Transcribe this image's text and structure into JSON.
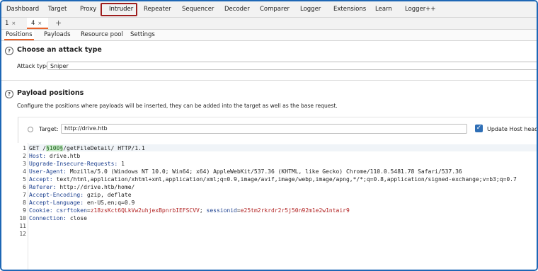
{
  "main_tabs": [
    "Dashboard",
    "Target",
    "Proxy",
    "Intruder",
    "Repeater",
    "Sequencer",
    "Decoder",
    "Comparer",
    "Logger",
    "Extensions",
    "Learn",
    "Logger++"
  ],
  "active_main_tab": "Intruder",
  "instance_tabs": [
    {
      "label": "1",
      "close": "×"
    },
    {
      "label": "4",
      "close": "×"
    }
  ],
  "add_tab_icon": "+",
  "sub_tabs": [
    "Positions",
    "Payloads",
    "Resource pool",
    "Settings"
  ],
  "attack_type_section": {
    "icon": "?",
    "title": "Choose an attack type",
    "label": "Attack type:",
    "value": "Sniper"
  },
  "payload_section": {
    "icon": "?",
    "title": "Payload positions",
    "description": "Configure the positions where payloads will be inserted, they can be added into the target as well as the base request."
  },
  "target": {
    "label": "Target:",
    "value": "http://drive.htb",
    "update_host_label": "Update Host header t",
    "update_host_checked": true
  },
  "request": {
    "line1_prefix": "GET /",
    "line1_payload": "§100§",
    "line1_suffix": "/getFileDetail/ HTTP/1.1",
    "headers": [
      {
        "name": "Host",
        "value": "drive.htb"
      },
      {
        "name": "Upgrade-Insecure-Requests",
        "value": "1"
      },
      {
        "name": "User-Agent",
        "value": "Mozilla/5.0 (Windows NT 10.0; Win64; x64) AppleWebKit/537.36 (KHTML, like Gecko) Chrome/110.0.5481.78 Safari/537.36"
      },
      {
        "name": "Accept",
        "value": "text/html,application/xhtml+xml,application/xml;q=0.9,image/avif,image/webp,image/apng,*/*;q=0.8,application/signed-exchange;v=b3;q=0.7"
      },
      {
        "name": "Referer",
        "value": "http://drive.htb/home/"
      },
      {
        "name": "Accept-Encoding",
        "value": "gzip, deflate"
      },
      {
        "name": "Accept-Language",
        "value": "en-US,en;q=0.9"
      }
    ],
    "cookie": {
      "name": "Cookie",
      "csrf_key": "csrftoken",
      "csrf_value": "z18zsKct6QLkVw2uhjexBpnrbIEFSCVV",
      "session_key": "sessionid",
      "session_value": "e25tm2rkrdr2r5j50n92m1e2w1ntair9"
    },
    "connection": {
      "name": "Connection",
      "value": "close"
    },
    "line_numbers": [
      "1",
      "2",
      "3",
      "4",
      "5",
      "6",
      "7",
      "8",
      "9",
      "10",
      "11",
      "12"
    ]
  },
  "colors": {
    "accent": "#e8632b",
    "highlight_box": "#9e1d1d",
    "frame": "#1e67b5",
    "checkbox": "#2f6fb6"
  }
}
